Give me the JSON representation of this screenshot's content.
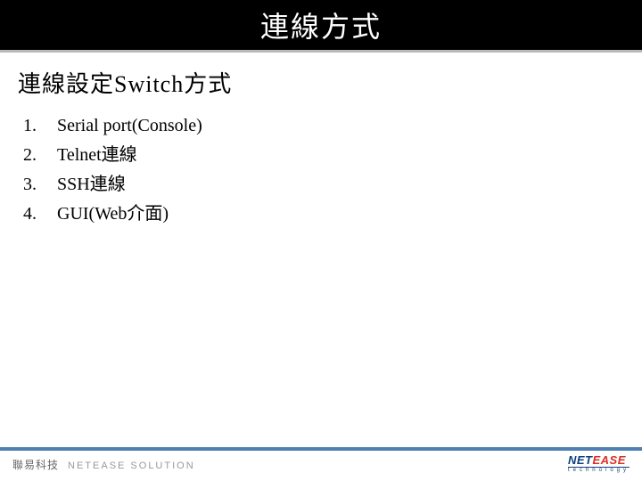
{
  "title": "連線方式",
  "subtitle": "連線設定Switch方式",
  "methods": [
    {
      "num": "1.",
      "text": "Serial port(Console)"
    },
    {
      "num": "2.",
      "text": "Telnet連線"
    },
    {
      "num": "3.",
      "text": "SSH連線"
    },
    {
      "num": "4.",
      "text": "GUI(Web介面)"
    }
  ],
  "footer": {
    "left_cjk": "聯易科技",
    "left_latin": "NETEASE SOLUTION",
    "brand_a": "NET",
    "brand_b": "EASE",
    "brand_sub": "technology"
  },
  "colors": {
    "accent_bar": "#4f7fb3",
    "brand_blue": "#0f3f7f",
    "brand_red": "#d93024"
  }
}
